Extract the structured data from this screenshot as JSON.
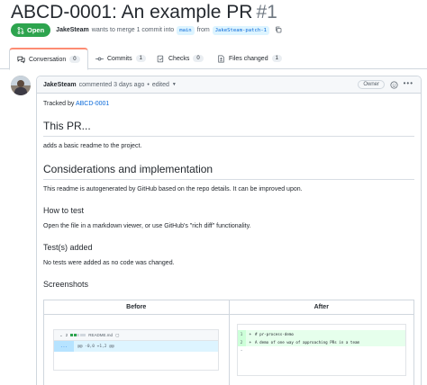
{
  "pr": {
    "title": "ABCD-0001: An example PR",
    "number": "#1",
    "state": "Open",
    "author": "JakeSteam",
    "merge_text": "wants to merge 1 commit into",
    "base_branch": "main",
    "from_text": "from",
    "head_branch": "JakeSteam-patch-1"
  },
  "tabs": [
    {
      "label": "Conversation",
      "count": "0",
      "icon": "comment-discussion-icon"
    },
    {
      "label": "Commits",
      "count": "1",
      "icon": "git-commit-icon"
    },
    {
      "label": "Checks",
      "count": "0",
      "icon": "checklist-icon"
    },
    {
      "label": "Files changed",
      "count": "1",
      "icon": "file-diff-icon"
    }
  ],
  "comment": {
    "author": "JakeSteam",
    "time_text": "commented 3 days ago",
    "separator": "•",
    "edited": "edited",
    "owner_badge": "Owner",
    "tracked_by_text": "Tracked by",
    "tracked_by_link": "ABCD-0001",
    "h_this_pr": "This PR...",
    "this_pr_text": "adds a basic readme to the project.",
    "h_considerations": "Considerations and implementation",
    "considerations_text": "This readme is autogenerated by GitHub based on the repo details. It can be improved upon.",
    "h_how_to_test": "How to test",
    "how_to_test_text": "Open the file in a markdown viewer, or use GitHub's \"rich diff\" functionality.",
    "h_tests_added": "Test(s) added",
    "tests_added_text": "No tests were added as no code was changed.",
    "h_screenshots": "Screenshots",
    "screenshots": {
      "before_label": "Before",
      "after_label": "After",
      "before_file": "README.md",
      "before_hunk": "@@ -0,0 +1,2 @@",
      "before_expand": "...",
      "after_lines": [
        {
          "num": "1",
          "sign": "+",
          "code": "# pr-process-demo"
        },
        {
          "num": "2",
          "sign": "+",
          "code": "A demo of one way of approaching PRs in a team"
        }
      ]
    }
  },
  "colors": {
    "open_green": "#2da44e",
    "link_blue": "#0969da",
    "tab_accent": "#fd8c73"
  }
}
